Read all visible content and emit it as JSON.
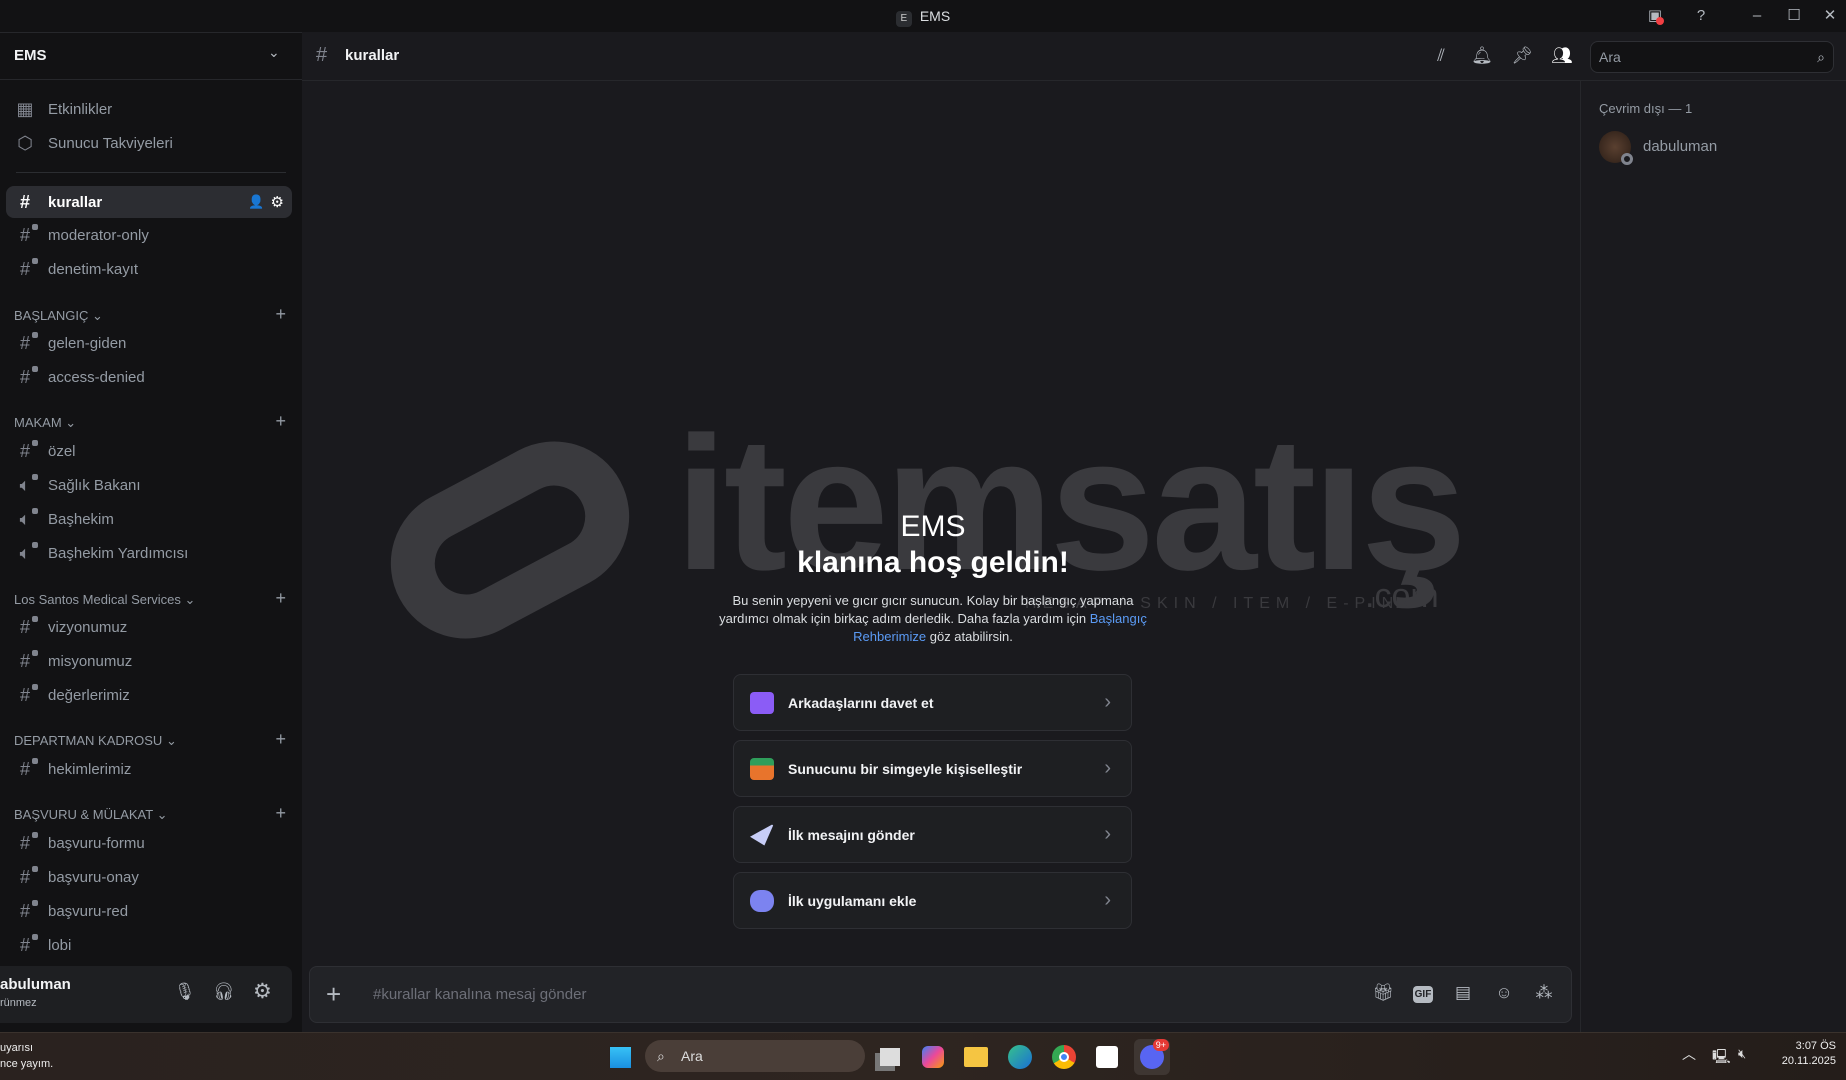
{
  "window": {
    "title": "EMS",
    "app_badge": "E"
  },
  "sidebar": {
    "server_name": "EMS",
    "top_items": [
      {
        "label": "Etkinlikler",
        "icon": "calendar-icon"
      },
      {
        "label": "Sunucu Takviyeleri",
        "icon": "boost-icon"
      }
    ],
    "channels_top": [
      {
        "label": "kurallar",
        "active": true
      },
      {
        "label": "moderator-only",
        "locked": true
      },
      {
        "label": "denetim-kayıt",
        "locked": true
      }
    ],
    "categories": [
      {
        "name": "BAŞLANGIÇ",
        "channels": [
          {
            "label": "gelen-giden",
            "type": "text"
          },
          {
            "label": "access-denied",
            "type": "text"
          }
        ]
      },
      {
        "name": "MAKAM",
        "channels": [
          {
            "label": "özel",
            "type": "text"
          },
          {
            "label": "Sağlık Bakanı",
            "type": "voice"
          },
          {
            "label": "Başhekim",
            "type": "voice"
          },
          {
            "label": "Başhekim Yardımcısı",
            "type": "voice"
          }
        ]
      },
      {
        "name": "Los Santos Medical Services",
        "channels": [
          {
            "label": "vizyonumuz",
            "type": "text"
          },
          {
            "label": "misyonumuz",
            "type": "text"
          },
          {
            "label": "değerlerimiz",
            "type": "text"
          }
        ]
      },
      {
        "name": "DEPARTMAN KADROSU",
        "channels": [
          {
            "label": "hekimlerimiz",
            "type": "text"
          }
        ]
      },
      {
        "name": "BAŞVURU & MÜLAKAT",
        "channels": [
          {
            "label": "başvuru-formu",
            "type": "text"
          },
          {
            "label": "başvuru-onay",
            "type": "text"
          },
          {
            "label": "başvuru-red",
            "type": "text"
          },
          {
            "label": "lobi",
            "type": "text"
          }
        ]
      }
    ],
    "user": {
      "name": "abuluman",
      "status": "rünmez"
    }
  },
  "header": {
    "channel": "kurallar",
    "search_placeholder": "Ara"
  },
  "members": {
    "section": "Çevrim dışı — 1",
    "list": [
      {
        "name": "dabuluman",
        "status": "offline"
      }
    ]
  },
  "watermark": {
    "brand": "itemsatış",
    "domain": ".com",
    "tagline": "HESAP / SKIN / ITEM / E-PIN"
  },
  "welcome": {
    "server": "EMS",
    "title": "klanına hoş geldin!",
    "desc_before": "Bu senin yepyeni ve gıcır gıcır sunucun. Kolay bir başlangıç yapmana yardımcı olmak için birkaç adım derledik. Daha fazla yardım için ",
    "desc_link": "Başlangıç Rehberimize",
    "desc_after": " göz atabilirsin.",
    "cards": [
      {
        "label": "Arkadaşlarını davet et",
        "color": "#8b5cf6"
      },
      {
        "label": "Sunucunu bir simgeyle kişiselleştir",
        "color": "#e8742c"
      },
      {
        "label": "İlk mesajını gönder",
        "color": "#c7cdf7"
      },
      {
        "label": "İlk uygulamanı ekle",
        "color": "#7c83f0"
      }
    ]
  },
  "composer": {
    "placeholder": "#kurallar kanalına mesaj gönder"
  },
  "taskbar": {
    "notification_line1": "uyarısı",
    "notification_line2": "nce yayım.",
    "search_placeholder": "Ara",
    "discord_badge": "9+",
    "time": "3:07 ÖS",
    "date": "20.11.2025"
  }
}
